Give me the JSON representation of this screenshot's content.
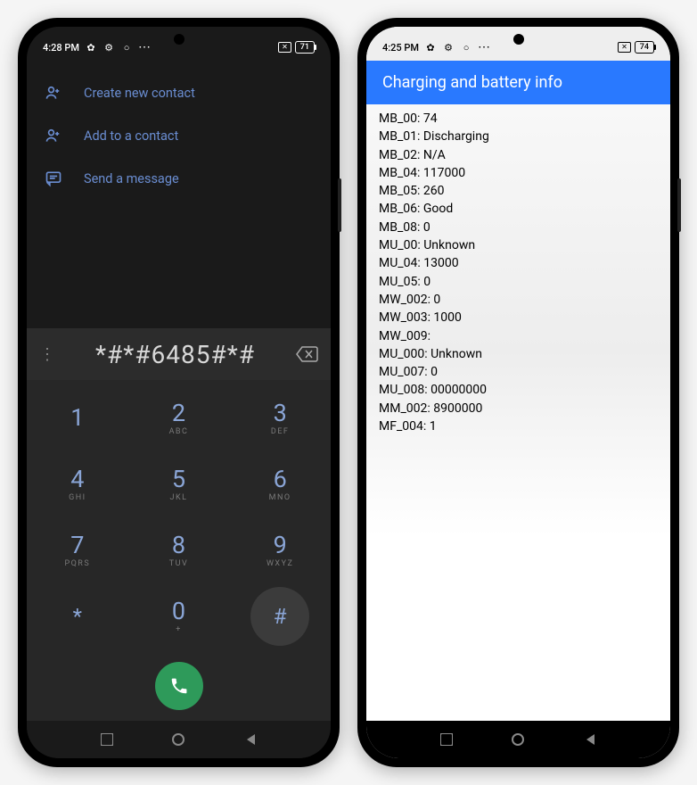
{
  "phone1": {
    "status": {
      "time": "4:28 PM",
      "battery": "71"
    },
    "menu": [
      {
        "icon": "person-add",
        "label": "Create new contact"
      },
      {
        "icon": "person-add",
        "label": "Add to a contact"
      },
      {
        "icon": "message",
        "label": "Send a message"
      }
    ],
    "dialed": "*#*#6485#*#",
    "keys": [
      {
        "d": "1",
        "l": ""
      },
      {
        "d": "2",
        "l": "ABC"
      },
      {
        "d": "3",
        "l": "DEF"
      },
      {
        "d": "4",
        "l": "GHI"
      },
      {
        "d": "5",
        "l": "JKL"
      },
      {
        "d": "6",
        "l": "MNO"
      },
      {
        "d": "7",
        "l": "PQRS"
      },
      {
        "d": "8",
        "l": "TUV"
      },
      {
        "d": "9",
        "l": "WXYZ"
      },
      {
        "d": "*",
        "l": ""
      },
      {
        "d": "0",
        "l": "+"
      },
      {
        "d": "#",
        "l": ""
      }
    ]
  },
  "phone2": {
    "status": {
      "time": "4:25 PM",
      "battery": "74"
    },
    "title": "Charging and battery info",
    "rows": [
      {
        "k": "MB_00",
        "v": "74"
      },
      {
        "k": "MB_01",
        "v": "Discharging"
      },
      {
        "k": "MB_02",
        "v": "N/A"
      },
      {
        "k": "MB_04",
        "v": "117000"
      },
      {
        "k": "MB_05",
        "v": "260"
      },
      {
        "k": "MB_06",
        "v": "Good"
      },
      {
        "k": "MB_08",
        "v": "0"
      },
      {
        "k": "MU_00",
        "v": "Unknown"
      },
      {
        "k": "MU_04",
        "v": "13000"
      },
      {
        "k": "MU_05",
        "v": "0"
      },
      {
        "k": "MW_002",
        "v": "0"
      },
      {
        "k": "MW_003",
        "v": "1000"
      },
      {
        "k": "MW_009",
        "v": ""
      },
      {
        "k": "MU_000",
        "v": "Unknown"
      },
      {
        "k": "MU_007",
        "v": "0"
      },
      {
        "k": "MU_008",
        "v": "00000000"
      },
      {
        "k": "MM_002",
        "v": "8900000"
      },
      {
        "k": "MF_004",
        "v": "1"
      }
    ]
  }
}
